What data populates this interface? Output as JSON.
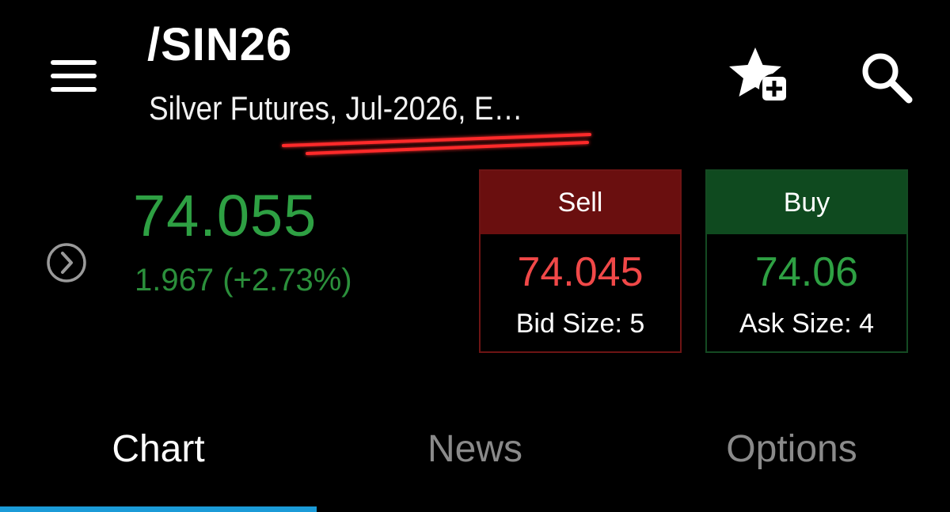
{
  "header": {
    "symbol": "/SIN26",
    "description": "Silver Futures, Jul-2026, E…",
    "menu_icon": "hamburger-menu-icon",
    "watchlist_icon": "star-plus-icon",
    "search_icon": "search-icon"
  },
  "quote": {
    "last_price": "74.055",
    "net_change": "1.967 (+2.73%)",
    "expand_icon": "chevron-right-circle-icon"
  },
  "trade": {
    "sell": {
      "label": "Sell",
      "price": "74.045",
      "size_text": "Bid Size: 5"
    },
    "buy": {
      "label": "Buy",
      "price": "74.06",
      "size_text": "Ask Size: 4"
    }
  },
  "tabs": [
    {
      "label": "Chart",
      "active": true
    },
    {
      "label": "News",
      "active": false
    },
    {
      "label": "Options",
      "active": false
    }
  ],
  "colors": {
    "up": "#2ea043",
    "down": "#f04848",
    "sell_header": "#6a0f0f",
    "buy_header": "#0f4a1f",
    "active_tab_indicator": "#1b9bd8",
    "inactive_tab": "#8a8a8a",
    "annotation_underline": "#ff2a2a"
  }
}
